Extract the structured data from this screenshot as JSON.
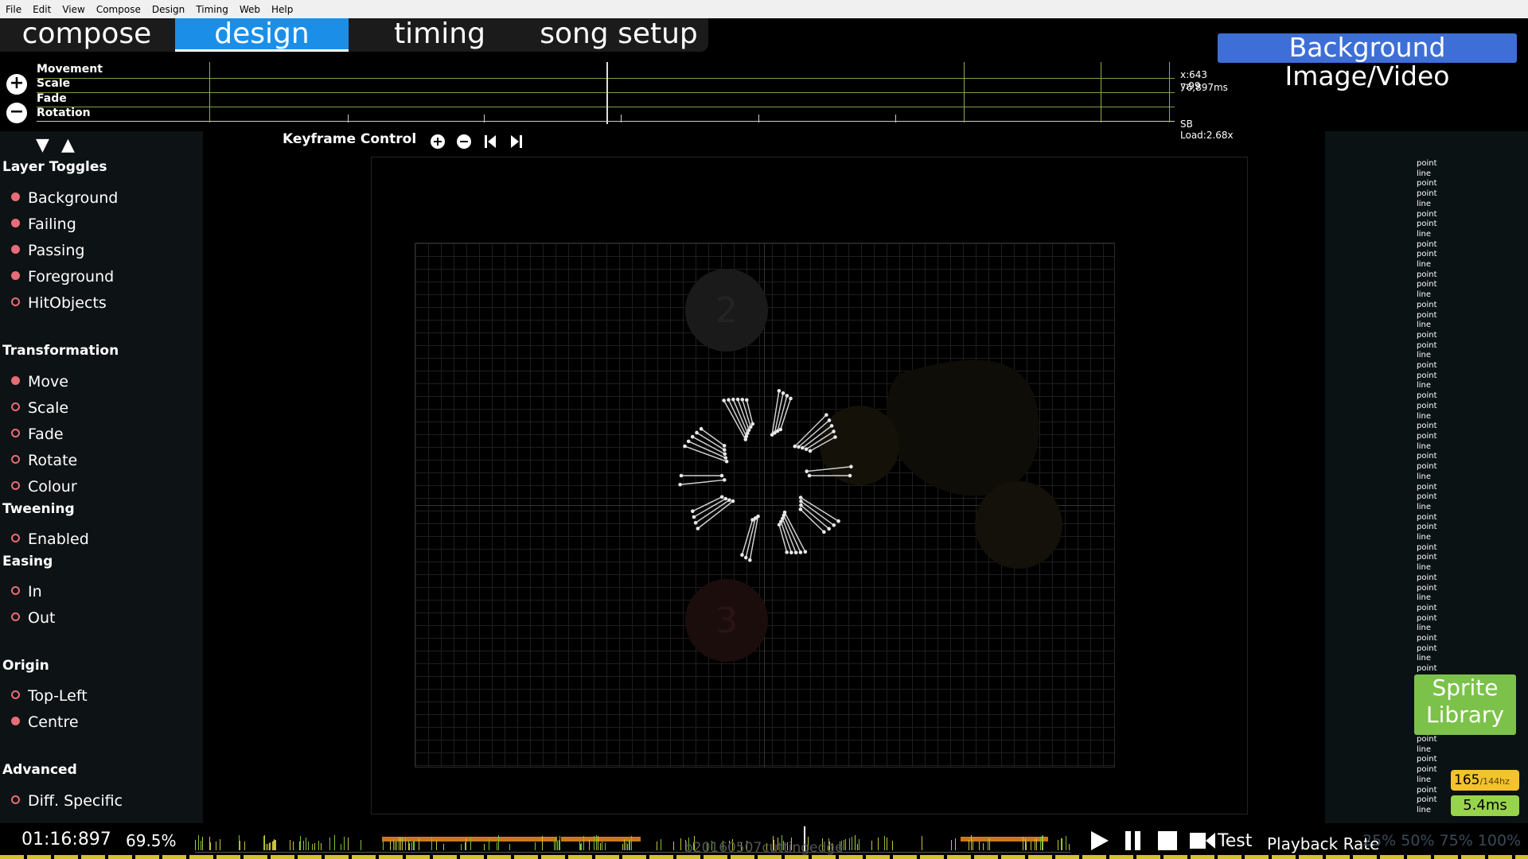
{
  "menu": [
    "File",
    "Edit",
    "View",
    "Compose",
    "Design",
    "Timing",
    "Web",
    "Help"
  ],
  "tabs": [
    {
      "label": "compose",
      "active": false
    },
    {
      "label": "design",
      "active": true
    },
    {
      "label": "timing",
      "active": false
    },
    {
      "label": "song setup",
      "active": false
    }
  ],
  "background_button": "Background Image/Video",
  "keyframes": {
    "tracks": [
      "Movement",
      "Scale",
      "Fade",
      "Rotation"
    ],
    "coords": "x:643 y:99",
    "time": "76,897ms",
    "sb_load": "SB Load:2.68x"
  },
  "sections": {
    "layer_toggles": "Layer Toggles",
    "transformation": "Transformation",
    "tweening": "Tweening",
    "easing": "Easing",
    "origin": "Origin",
    "advanced": "Advanced"
  },
  "layers": [
    {
      "label": "Background",
      "checked": true
    },
    {
      "label": "Failing",
      "checked": true
    },
    {
      "label": "Passing",
      "checked": true
    },
    {
      "label": "Foreground",
      "checked": true
    },
    {
      "label": "HitObjects",
      "checked": false
    }
  ],
  "transforms": [
    {
      "label": "Move",
      "checked": true
    },
    {
      "label": "Scale",
      "checked": false
    },
    {
      "label": "Fade",
      "checked": false
    },
    {
      "label": "Rotate",
      "checked": false
    },
    {
      "label": "Colour",
      "checked": false
    }
  ],
  "tweening": [
    {
      "label": "Enabled",
      "checked": false
    }
  ],
  "easing": [
    {
      "label": "In",
      "checked": false
    },
    {
      "label": "Out",
      "checked": false
    }
  ],
  "origin": [
    {
      "label": "Top-Left",
      "checked": false
    },
    {
      "label": "Centre",
      "checked": true
    }
  ],
  "advanced": [
    {
      "label": "Diff. Specific",
      "checked": false
    }
  ],
  "keyframe_control": "Keyframe Control",
  "playfield_numbers": [
    "2",
    "3"
  ],
  "sprite_list": [
    "point",
    "line",
    "point",
    "point",
    "line",
    "point",
    "point",
    "line",
    "point",
    "point",
    "line",
    "point",
    "point",
    "line",
    "point",
    "point",
    "line",
    "point",
    "point",
    "line",
    "point",
    "point",
    "line",
    "point",
    "point",
    "line",
    "point",
    "point",
    "line",
    "point",
    "point",
    "line",
    "point",
    "point",
    "line",
    "point",
    "point",
    "line",
    "point",
    "point",
    "line",
    "point",
    "point",
    "line",
    "point",
    "point",
    "line",
    "point",
    "point",
    "line",
    "point",
    "point",
    "line",
    "point",
    "point",
    "line",
    "point",
    "point",
    "line",
    "point",
    "point",
    "line",
    "point",
    "point",
    "line"
  ],
  "sprite_library": "Sprite Library",
  "fps": {
    "value": "165",
    "refresh": "/144hz"
  },
  "frame_time": "5.4ms",
  "playback": {
    "time": "01:16:897",
    "percent": "69.5%",
    "song": "b20160507cuttingedge",
    "test_label": "Test",
    "rate_label": "Playback Rate",
    "rates": [
      "25%",
      "50%",
      "75%",
      "100%"
    ]
  }
}
